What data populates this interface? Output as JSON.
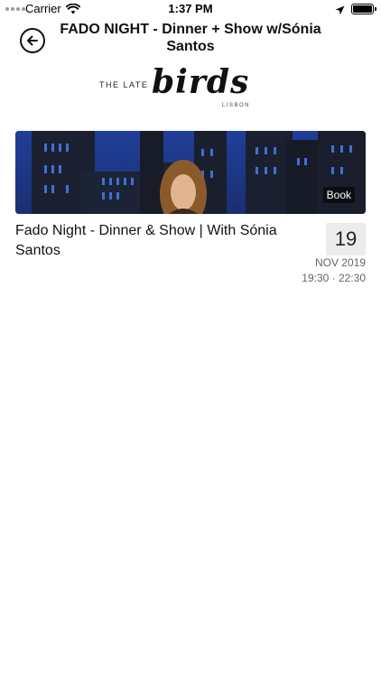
{
  "status_bar": {
    "carrier": "Carrier",
    "time": "1:37 PM",
    "icons": [
      "signal-dots-icon",
      "wifi-icon",
      "location-arrow-icon",
      "battery-icon"
    ]
  },
  "nav": {
    "title": "FADO NIGHT - Dinner + Show w/Sónia Santos",
    "back_icon": "back-arrow-icon"
  },
  "logo": {
    "prefix": "THE LATE",
    "script": "birds",
    "sub": "LISBON"
  },
  "event": {
    "title": "Fado Night - Dinner & Show | With Sónia Santos",
    "book_label": "Book",
    "day": "19",
    "month_year": "NOV 2019",
    "time_range": "19:30 · 22:30"
  },
  "colors": {
    "background": "#ffffff",
    "text": "#111111",
    "muted": "#666666",
    "date_box": "#ececec",
    "image_blue": "#1e3a8c"
  }
}
